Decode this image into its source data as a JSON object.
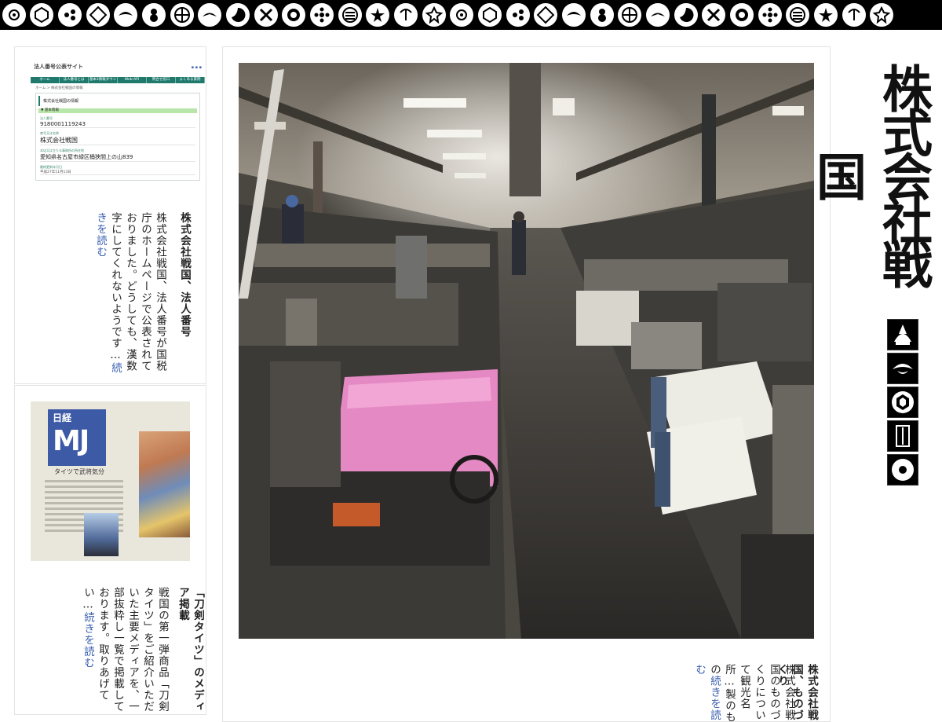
{
  "brand": {
    "name": "株式会社戦国"
  },
  "kamon_strip": {
    "icons": [
      "maru-ni-mitsuba-icon",
      "kikko-icon",
      "mitsu-domoe-icon",
      "kyo-kanoko-icon",
      "ageha-icon",
      "hyotan-icon",
      "maru-juji-icon",
      "tsuru-icon",
      "tomoe-icon",
      "chigai-ya-icon",
      "mokko-icon",
      "kuyo-icon",
      "maru-ni-mitsu-hiki-icon",
      "sakura-icon",
      "kiri-icon",
      "kikyo-icon",
      "janome-icon",
      "kikko-hanabishi-icon",
      "hana-icon",
      "kikko-icon",
      "mitsu-domoe-icon",
      "kyo-kanoko-icon",
      "ageha-icon",
      "hyotan-icon",
      "maru-juji-icon",
      "tsuru-icon",
      "tomoe-icon",
      "chigai-ya-icon",
      "mokko-icon",
      "kuyo-icon",
      "maru-ni-mitsu-hiki-icon",
      "sakura-icon"
    ]
  },
  "side_nav": {
    "items": [
      {
        "icon": "kabuto-icon"
      },
      {
        "icon": "ageha-icon"
      },
      {
        "icon": "kikko-icon"
      },
      {
        "icon": "sword-icon"
      },
      {
        "icon": "janome-icon"
      }
    ]
  },
  "posts": [
    {
      "title": "株式会社戦国、法人番号",
      "body": "株式会社戦国、法人番号が国税庁のホームページで公表されておりました。どうしても、漢数字にしてくれないようです…",
      "more": "続きを読む",
      "thumbnail": {
        "site_title": "法人番号公表サイト",
        "nav": [
          "ホーム",
          "法人番号とは",
          "基本3情報ダウンロード",
          "Web-API",
          "問合せ窓口",
          "よくある質問"
        ],
        "crumb": "ホーム > 株式会社戦国の情報",
        "section_head": "株式会社戦国の情報",
        "bar_label": "▼ 基本情報",
        "fields": [
          {
            "label": "法人番号",
            "value": "9180001119243"
          },
          {
            "label": "商号又は名称",
            "value": "株式会社戦国"
          },
          {
            "label": "本店又は主たる事務所の所在地",
            "value": "愛知県名古屋市緑区桶狭間上の山839"
          },
          {
            "label": "最終更新年月日",
            "value": "平成27年11月13日"
          }
        ]
      }
    },
    {
      "title": "「刀剣タイツ」のメディア掲載",
      "body": "戦国の第一弾商品「刀剣タイツ」をご紹介いただいた主要メディアを、一部抜粋し一覧で掲載しております。取りあげてい…",
      "more": "続きを読む",
      "thumbnail": {
        "paper": "日経",
        "logo": "MJ",
        "headline": "タイツで武将気分"
      }
    },
    {
      "title": "株式会社戦国、ものづくり",
      "body": "株式会社戦国のものづくりについて観光名所…製のもの",
      "more": "続きを読む"
    }
  ]
}
